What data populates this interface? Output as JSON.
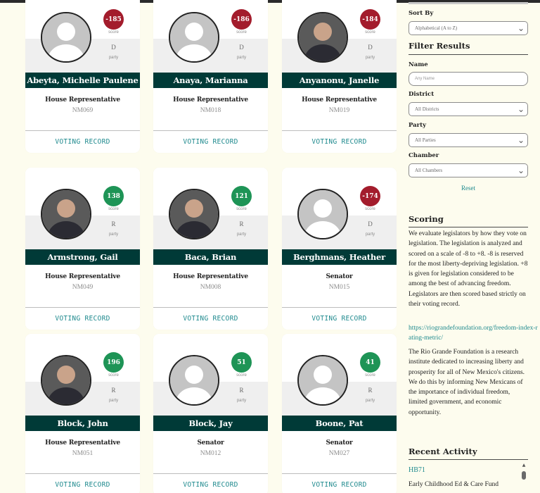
{
  "cards": [
    {
      "name": "Abeyta, Michelle Paulene",
      "score": "-185",
      "score_label": "score",
      "party": "D",
      "party_label": "party",
      "role": "House Representative",
      "district": "NM069",
      "action": "VOTING RECORD",
      "photo": "placeholder",
      "sentiment": "negative"
    },
    {
      "name": "Anaya, Marianna",
      "score": "-186",
      "score_label": "score",
      "party": "D",
      "party_label": "party",
      "role": "House Representative",
      "district": "NM018",
      "action": "VOTING RECORD",
      "photo": "placeholder",
      "sentiment": "negative"
    },
    {
      "name": "Anyanonu, Janelle",
      "score": "-184",
      "score_label": "score",
      "party": "D",
      "party_label": "party",
      "role": "House Representative",
      "district": "NM019",
      "action": "VOTING RECORD",
      "photo": "portrait",
      "sentiment": "negative"
    },
    {
      "name": "Armstrong, Gail",
      "score": "138",
      "score_label": "score",
      "party": "R",
      "party_label": "party",
      "role": "House Representative",
      "district": "NM049",
      "action": "VOTING RECORD",
      "photo": "portrait",
      "sentiment": "positive"
    },
    {
      "name": "Baca, Brian",
      "score": "121",
      "score_label": "score",
      "party": "R",
      "party_label": "party",
      "role": "House Representative",
      "district": "NM008",
      "action": "VOTING RECORD",
      "photo": "portrait",
      "sentiment": "positive"
    },
    {
      "name": "Berghmans, Heather",
      "score": "-174",
      "score_label": "score",
      "party": "D",
      "party_label": "party",
      "role": "Senator",
      "district": "NM015",
      "action": "VOTING RECORD",
      "photo": "placeholder",
      "sentiment": "negative"
    },
    {
      "name": "Block, John",
      "score": "196",
      "score_label": "score",
      "party": "R",
      "party_label": "party",
      "role": "House Representative",
      "district": "NM051",
      "action": "VOTING RECORD",
      "photo": "portrait",
      "sentiment": "positive"
    },
    {
      "name": "Block, Jay",
      "score": "51",
      "score_label": "score",
      "party": "R",
      "party_label": "party",
      "role": "Senator",
      "district": "NM012",
      "action": "VOTING RECORD",
      "photo": "placeholder",
      "sentiment": "positive"
    },
    {
      "name": "Boone, Pat",
      "score": "41",
      "score_label": "score",
      "party": "R",
      "party_label": "party",
      "role": "Senator",
      "district": "NM027",
      "action": "VOTING RECORD",
      "photo": "placeholder",
      "sentiment": "positive"
    }
  ],
  "sidebar": {
    "sort_label": "Sort By",
    "sort_value": "Alphabetical (A to Z)",
    "filter_heading": "Filter Results",
    "name_label": "Name",
    "name_placeholder": "Any Name",
    "district_label": "District",
    "district_value": "All Districts",
    "party_label": "Party",
    "party_value": "All Parties",
    "chamber_label": "Chamber",
    "chamber_value": "All Chambers",
    "reset_label": "Reset",
    "scoring_heading": "Scoring",
    "scoring_text": "We evaluate legislators by how they vote on legislation. The legislation is analyzed and scored on a scale of -8 to +8. -8 is reserved for the most liberty-depriving legislation. +8 is given for legislation considered to be among the best of advancing freedom. Legislators are then scored based strictly on their voting record.",
    "scoring_link": "https://riograndefoundation.org/freedom-index-rating-metric/",
    "about_text": "The Rio Grande Foundation is a research institute dedicated to increasing liberty and prosperity for all of New Mexico's citizens. We do this by informing New Mexicans of the importance of individual freedom, limited government, and economic opportunity.",
    "activity_heading": "Recent Activity",
    "activity_bill": "HB71",
    "activity_title": "Early Childhood Ed & Care Fund"
  },
  "colors": {
    "positive": "#1e9456",
    "negative": "#a31c2c",
    "name_band": "#003a37",
    "link": "#1f8a8e",
    "page_bg": "#fdfcee"
  }
}
